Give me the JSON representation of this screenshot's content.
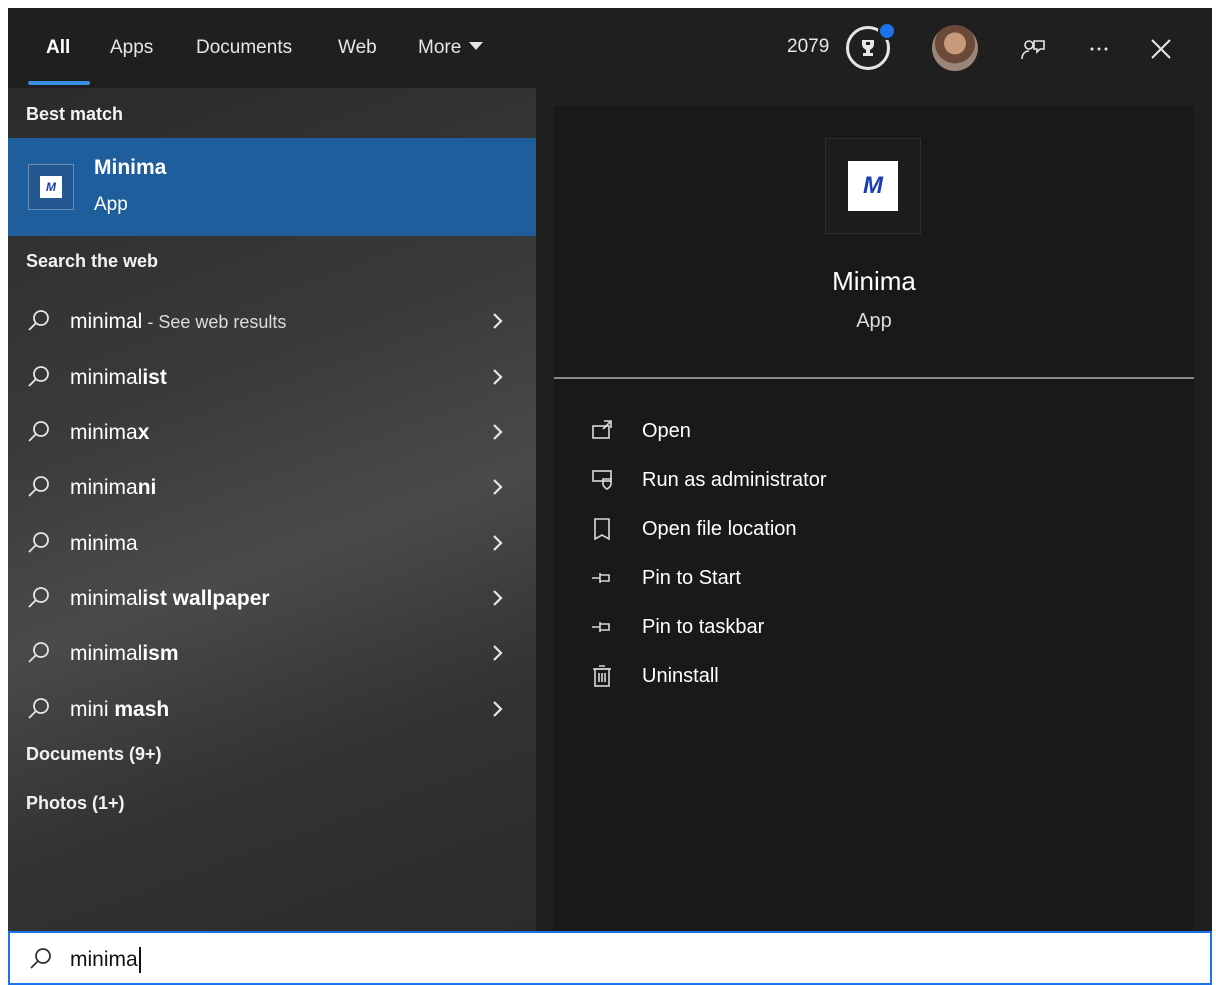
{
  "tabs": [
    {
      "label": "All",
      "active": true
    },
    {
      "label": "Apps"
    },
    {
      "label": "Documents"
    },
    {
      "label": "Web"
    },
    {
      "label": "More"
    }
  ],
  "topbar": {
    "points": "2079",
    "icons": [
      "trophy-icon",
      "avatar",
      "feedback-icon",
      "more-options-icon",
      "close-icon"
    ]
  },
  "left": {
    "best_match_heading": "Best match",
    "best_match": {
      "title": "Minima",
      "subtitle": "App"
    },
    "web_heading": "Search the web",
    "suggestions": [
      {
        "prefix": "minimal",
        "bold": "",
        "hint": " - See web results"
      },
      {
        "prefix": "minimal",
        "bold": "ist",
        "hint": ""
      },
      {
        "prefix": "minima",
        "bold": "x",
        "hint": ""
      },
      {
        "prefix": "minima",
        "bold": "ni",
        "hint": ""
      },
      {
        "prefix": "minima",
        "bold": "",
        "hint": ""
      },
      {
        "prefix": "minimal",
        "bold": "ist wallpaper",
        "hint": ""
      },
      {
        "prefix": "minimal",
        "bold": "ism",
        "hint": ""
      },
      {
        "prefix": "mini",
        "bold": " mash",
        "hint": ""
      }
    ],
    "categories": [
      "Documents (9+)",
      "Photos (1+)"
    ]
  },
  "right": {
    "app_title": "Minima",
    "app_subtitle": "App",
    "actions": [
      {
        "label": "Open",
        "icon": "open-icon"
      },
      {
        "label": "Run as administrator",
        "icon": "shield-icon"
      },
      {
        "label": "Open file location",
        "icon": "file-location-icon"
      },
      {
        "label": "Pin to Start",
        "icon": "pin-icon"
      },
      {
        "label": "Pin to taskbar",
        "icon": "pin-icon"
      },
      {
        "label": "Uninstall",
        "icon": "trash-icon"
      }
    ]
  },
  "search": {
    "query": "minima"
  },
  "colors": {
    "accent": "#1a73e8",
    "selected_bg": "#1f5e9c",
    "pane_bg": "#1f1f1f"
  }
}
